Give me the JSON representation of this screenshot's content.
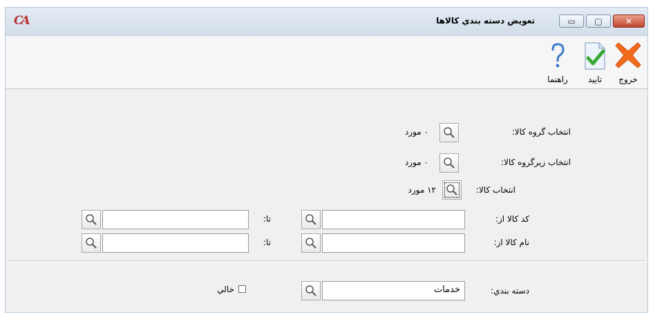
{
  "window": {
    "title": "تعويض دسته بندي کالاها",
    "logo_text": "CA",
    "controls": {
      "minimize": "▭",
      "restore": "▢",
      "close": "✕"
    }
  },
  "toolbar": {
    "exit_label": "خروج",
    "confirm_label": "تاييد",
    "help_label": "راهنما",
    "icons": {
      "exit": "close-x-icon",
      "confirm": "document-check-icon",
      "help": "question-icon"
    }
  },
  "filters": {
    "product_group": {
      "label": "انتخاب گروه کالا:",
      "count": "۰ مورد"
    },
    "product_subgroup": {
      "label": "انتخاب زيرگروه کالا:",
      "count": "۰ مورد"
    },
    "product": {
      "label": "انتخاب کالا:",
      "count": "۱۲ مورد"
    },
    "code": {
      "from_label": "کد کالا از:",
      "to_label": "تا:",
      "from_value": "",
      "to_value": ""
    },
    "name": {
      "from_label": "نام کالا از:",
      "to_label": "تا:",
      "from_value": "",
      "to_value": ""
    }
  },
  "category": {
    "label": "دسته بندي:",
    "value": "خدمات",
    "empty_label": "خالي",
    "empty_checked": false
  },
  "colors": {
    "window_bg": "#f0f0f0",
    "titlebar": "#d9e4f0",
    "close_button": "#c94a31",
    "exit_icon": "#f26a1b",
    "confirm_icon": "#3aa935",
    "help_icon": "#3a7bc8"
  }
}
